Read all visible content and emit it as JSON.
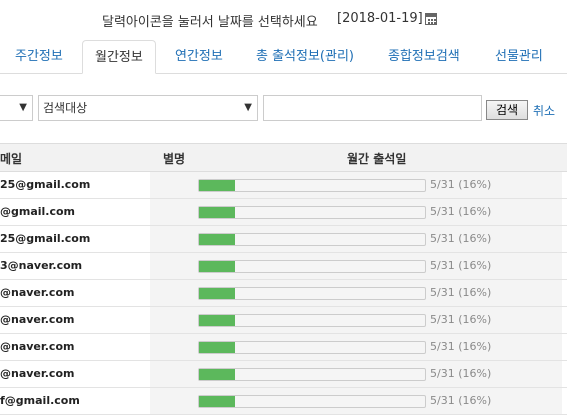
{
  "header": {
    "instruction": "달력아이콘을 눌러서 날짜를 선택하세요",
    "date": "[2018-01-19]",
    "icon": "calendar-icon"
  },
  "tabs": [
    {
      "label": "주간정보",
      "active": false
    },
    {
      "label": "월간정보",
      "active": true
    },
    {
      "label": "연간정보",
      "active": false
    },
    {
      "label": "총 출석정보(관리)",
      "active": false
    },
    {
      "label": "종합정보검색",
      "active": false
    },
    {
      "label": "선물관리",
      "active": false
    }
  ],
  "filters": {
    "select1_value": "",
    "select2_value": "검색대상",
    "search_input_value": "",
    "search_button": "검색",
    "cancel_link": "취소"
  },
  "table": {
    "headers": {
      "email": "메일",
      "name": "별명",
      "attendance": "월간 출석일"
    },
    "rows": [
      {
        "email": "25@gmail.com",
        "name": "",
        "label": "5/31 (16%)",
        "progress": 0.16
      },
      {
        "email": "@gmail.com",
        "name": "",
        "label": "5/31 (16%)",
        "progress": 0.16
      },
      {
        "email": "25@gmail.com",
        "name": "",
        "label": "5/31 (16%)",
        "progress": 0.16
      },
      {
        "email": "3@naver.com",
        "name": "",
        "label": "5/31 (16%)",
        "progress": 0.16
      },
      {
        "email": "@naver.com",
        "name": "",
        "label": "5/31 (16%)",
        "progress": 0.16
      },
      {
        "email": "@naver.com",
        "name": "",
        "label": "5/31 (16%)",
        "progress": 0.16
      },
      {
        "email": "@naver.com",
        "name": "",
        "label": "5/31 (16%)",
        "progress": 0.16
      },
      {
        "email": "@naver.com",
        "name": "",
        "label": "5/31 (16%)",
        "progress": 0.16
      },
      {
        "email": "f@gmail.com",
        "name": "",
        "label": "5/31 (16%)",
        "progress": 0.16
      }
    ]
  },
  "colors": {
    "link": "#1f6fb5",
    "progress": "#5cb85c",
    "header_bg": "#f2f2f2"
  }
}
